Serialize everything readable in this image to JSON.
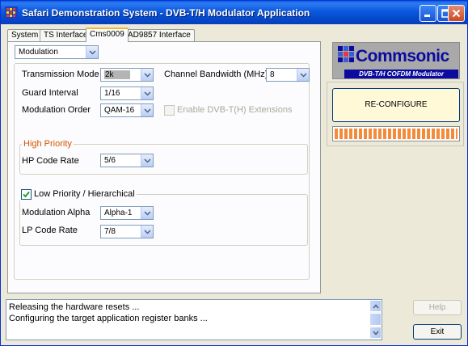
{
  "window": {
    "title": "Safari Demonstration System - DVB-T/H Modulator Application"
  },
  "tabs": [
    {
      "label": "System",
      "active": false
    },
    {
      "label": "TS Interface",
      "active": false
    },
    {
      "label": "Cms0009",
      "active": true
    },
    {
      "label": "AD9857 Interface",
      "active": false
    }
  ],
  "section_select": {
    "value": "Modulation"
  },
  "modulation": {
    "transmission_mode_label": "Transmission Mode",
    "transmission_mode_value": "2k",
    "channel_bandwidth_label": "Channel Bandwidth (MHz)",
    "channel_bandwidth_value": "8",
    "guard_interval_label": "Guard Interval",
    "guard_interval_value": "1/16",
    "modulation_order_label": "Modulation Order",
    "modulation_order_value": "QAM-16",
    "dvbth_ext_label": "Enable DVB-T(H) Extensions",
    "dvbth_ext_checked": false
  },
  "high_priority": {
    "title": "High Priority",
    "hp_code_rate_label": "HP Code Rate",
    "hp_code_rate_value": "5/6"
  },
  "low_priority": {
    "title": "Low Priority / Hierarchical",
    "checked": true,
    "alpha_label": "Modulation Alpha",
    "alpha_value": "Alpha-1",
    "lp_code_rate_label": "LP Code Rate",
    "lp_code_rate_value": "7/8"
  },
  "logo": {
    "name": "Commsonic",
    "tagline": "DVB-T/H COFDM Modulator"
  },
  "reconfigure_label": "RE-CONFIGURE",
  "progress": {
    "fraction": 1.0
  },
  "log": {
    "lines": [
      "Releasing the hardware resets ...",
      "Configuring the target application register banks ..."
    ]
  },
  "buttons": {
    "help": "Help",
    "exit": "Exit"
  },
  "colors": {
    "accent_orange": "#d35400",
    "logo_blue": "#0b0ba0",
    "progress_orange": "#f28b3c"
  }
}
